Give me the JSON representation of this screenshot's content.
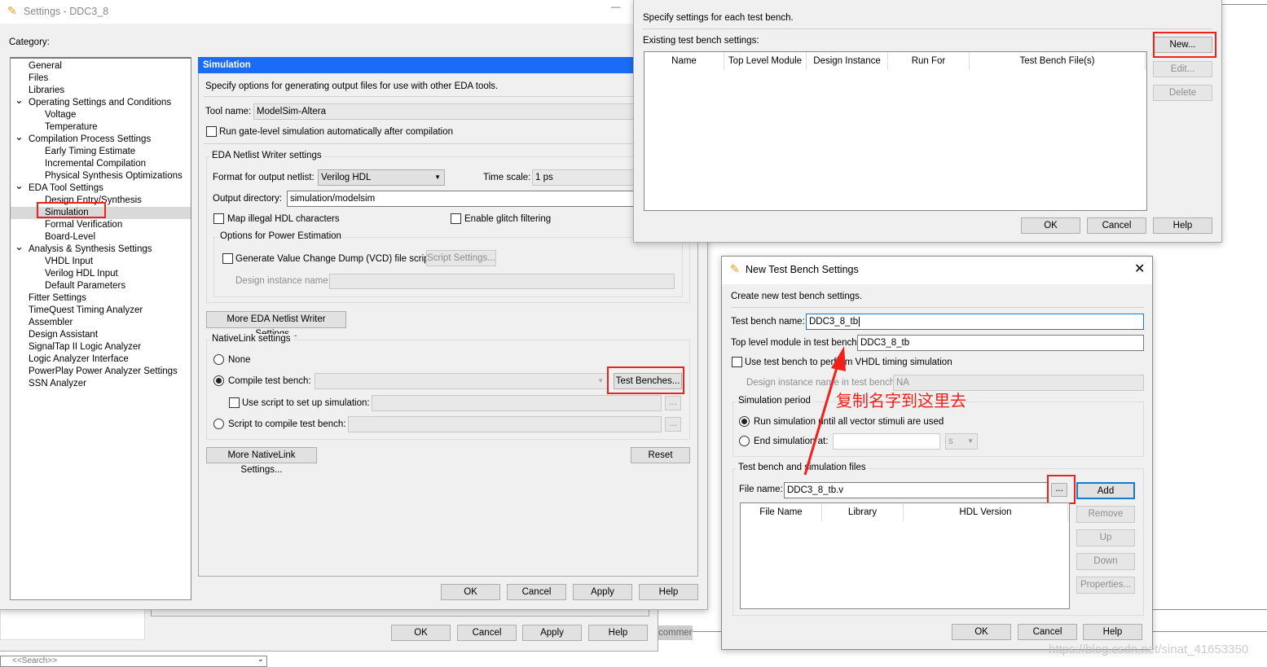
{
  "background_window": {
    "buttons": {
      "ok": "OK",
      "cancel": "Cancel",
      "apply": "Apply",
      "help": "Help"
    },
    "search_placeholder": "<<Search>>",
    "partial_text": "commenc"
  },
  "settings": {
    "title": "Settings - DDC3_8",
    "category_label": "Category:",
    "tree": [
      {
        "label": "General",
        "level": 1
      },
      {
        "label": "Files",
        "level": 1
      },
      {
        "label": "Libraries",
        "level": 1
      },
      {
        "label": "Operating Settings and Conditions",
        "level": 1,
        "expanded": true
      },
      {
        "label": "Voltage",
        "level": 2
      },
      {
        "label": "Temperature",
        "level": 2
      },
      {
        "label": "Compilation Process Settings",
        "level": 1,
        "expanded": true
      },
      {
        "label": "Early Timing Estimate",
        "level": 2
      },
      {
        "label": "Incremental Compilation",
        "level": 2
      },
      {
        "label": "Physical Synthesis Optimizations",
        "level": 2
      },
      {
        "label": "EDA Tool Settings",
        "level": 1,
        "expanded": true
      },
      {
        "label": "Design Entry/Synthesis",
        "level": 2
      },
      {
        "label": "Simulation",
        "level": 2,
        "selected": true
      },
      {
        "label": "Formal Verification",
        "level": 2
      },
      {
        "label": "Board-Level",
        "level": 2
      },
      {
        "label": "Analysis & Synthesis Settings",
        "level": 1,
        "expanded": true
      },
      {
        "label": "VHDL Input",
        "level": 2
      },
      {
        "label": "Verilog HDL Input",
        "level": 2
      },
      {
        "label": "Default Parameters",
        "level": 2
      },
      {
        "label": "Fitter Settings",
        "level": 1
      },
      {
        "label": "TimeQuest Timing Analyzer",
        "level": 1
      },
      {
        "label": "Assembler",
        "level": 1
      },
      {
        "label": "Design Assistant",
        "level": 1
      },
      {
        "label": "SignalTap II Logic Analyzer",
        "level": 1
      },
      {
        "label": "Logic Analyzer Interface",
        "level": 1
      },
      {
        "label": "PowerPlay Power Analyzer Settings",
        "level": 1
      },
      {
        "label": "SSN Analyzer",
        "level": 1
      }
    ],
    "panel": {
      "header": "Simulation",
      "description": "Specify options for generating output files for use with other EDA tools.",
      "tool_name_label": "Tool name:",
      "tool_name": "ModelSim-Altera",
      "run_gate_level": "Run gate-level simulation automatically after compilation",
      "eda_group": "EDA Netlist Writer settings",
      "format_label": "Format for output netlist:",
      "format_value": "Verilog HDL",
      "time_scale_label": "Time scale:",
      "time_scale": "1 ps",
      "output_dir_label": "Output directory:",
      "output_dir": "simulation/modelsim",
      "map_illegal": "Map illegal HDL characters",
      "enable_glitch": "Enable glitch filtering",
      "power_group": "Options for Power Estimation",
      "gen_vcd": "Generate Value Change Dump (VCD) file script",
      "script_settings": "Script Settings...",
      "design_instance_label": "Design instance name:",
      "more_eda": "More EDA Netlist Writer Settings...",
      "nativelink_group": "NativeLink settings",
      "none": "None",
      "compile_tb": "Compile test bench:",
      "test_benches": "Test Benches...",
      "use_script": "Use script to set up simulation:",
      "browse": "...",
      "script_compile": "Script to compile test bench:",
      "more_nativelink": "More NativeLink Settings...",
      "reset": "Reset"
    },
    "buttons": {
      "ok": "OK",
      "cancel": "Cancel",
      "apply": "Apply",
      "help": "Help"
    }
  },
  "test_benches_dialog": {
    "description": "Specify settings for each test bench.",
    "existing_label": "Existing test bench settings:",
    "columns": [
      "Name",
      "Top Level Module",
      "Design Instance",
      "Run For",
      "Test Bench File(s)"
    ],
    "buttons": {
      "new": "New...",
      "edit": "Edit...",
      "delete": "Delete",
      "ok": "OK",
      "cancel": "Cancel",
      "help": "Help"
    }
  },
  "new_tb_dialog": {
    "title": "New Test Bench Settings",
    "description": "Create new test bench settings.",
    "tb_name_label": "Test bench name:",
    "tb_name": "DDC3_8_tb",
    "top_module_label": "Top level module in test bench:",
    "top_module": "DDC3_8_tb",
    "use_vhdl": "Use test bench to perform VHDL timing simulation",
    "design_instance_label": "Design instance name in test bench:",
    "design_instance": "NA",
    "sim_period_group": "Simulation period",
    "run_until": "Run simulation until all vector stimuli are used",
    "end_at": "End simulation at:",
    "end_unit": "s",
    "files_group": "Test bench and simulation files",
    "file_name_label": "File name:",
    "file_name": "DDC3_8_tb.v",
    "browse": "...",
    "columns": [
      "File Name",
      "Library",
      "HDL Version"
    ],
    "buttons": {
      "add": "Add",
      "remove": "Remove",
      "up": "Up",
      "down": "Down",
      "properties": "Properties...",
      "ok": "OK",
      "cancel": "Cancel",
      "help": "Help"
    }
  },
  "annotation": {
    "text": "复制名字到这里去",
    "color": "#f0201b"
  },
  "watermark": "https://blog.csdn.net/sinat_41653350",
  "colors": {
    "header_blue": "#1a6cf6",
    "highlight_red": "#f0201b"
  }
}
